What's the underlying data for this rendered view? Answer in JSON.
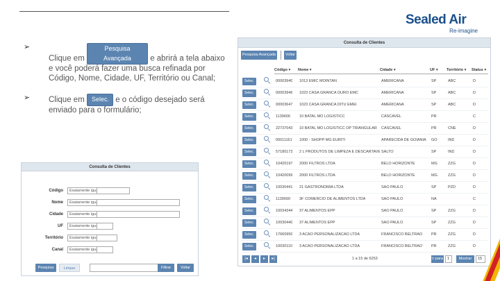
{
  "brand": {
    "name": "Sealed Air",
    "tagline": "Re-imagine",
    "colors": {
      "primary": "#1a4f8b",
      "button": "#5b84b1",
      "accent_red": "#d32027",
      "accent_yellow": "#f2b600"
    }
  },
  "bullets": [
    {
      "arrow": "➢",
      "before": "Clique em",
      "button": "Pesquisa Avançada",
      "after": "e abrirá a tela abaixo e você poderá fazer uma busca refinada por Código, Nome, Cidade, UF, Território ou Canal;"
    },
    {
      "arrow": "➢",
      "before": "Clique em",
      "button": "Selec.",
      "after": "e o código desejado será enviado para o formulário;"
    }
  ],
  "search_form": {
    "title": "Consulta de Clientes",
    "fields": [
      {
        "label": "Código",
        "operator": "Exatamente igual"
      },
      {
        "label": "Nome",
        "operator": "Exatamente igual"
      },
      {
        "label": "Cidade",
        "operator": "Exatamente igual"
      },
      {
        "label": "UF",
        "operator": "Exatamente igual"
      },
      {
        "label": "Território",
        "operator": "Exatamente igual"
      },
      {
        "label": "Canal",
        "operator": "Exatamente igual"
      }
    ],
    "buttons": {
      "search": "Pesquisa",
      "clear": "Limpar",
      "filter": "Filtrar",
      "back": "Voltar"
    }
  },
  "grid": {
    "title": "Consulta de Clientes",
    "toolbar": {
      "advanced": "Pesquisa Avançada",
      "back": "Voltar"
    },
    "columns": [
      "Código",
      "Nome",
      "Cidade",
      "UF",
      "Território",
      "Status"
    ],
    "select_label": "Selec.",
    "rows": [
      [
        "00003940",
        "1013 EMIC MOINTAN",
        "AMERICANA",
        "SP",
        "ABC",
        "D"
      ],
      [
        "00003946",
        "1023 CASA GRANCA OURO EMC",
        "AMERICANA",
        "SP",
        "ABC",
        "D"
      ],
      [
        "00003647",
        "1023 CASA GRANCA DITU EMEI",
        "AMERICANA",
        "SP",
        "ABC",
        "D"
      ],
      [
        "1139606",
        "10 BATAL MO LOGISTICC",
        "CASCAVEL",
        "PR",
        "",
        "C"
      ],
      [
        "22737043",
        "10 BATAL MO LOGISTICC OP TRIANGULAR",
        "CASCAVEL",
        "PR",
        "CNE",
        "D"
      ],
      [
        "00011161",
        "1000 - SHOPP MG EURITI",
        "APARECIDA DE GOIANIA",
        "GO",
        "IND",
        "D"
      ],
      [
        "57180173",
        "2 L PRODUTOS DE LIMPEZA E DESCARTAVEIS",
        "SALTO",
        "SP",
        "IND",
        "D"
      ],
      [
        "10420197",
        "2000 FILTROS LTDA",
        "BELO HORIZONTE",
        "MG",
        "ZZG",
        "D"
      ],
      [
        "10420099",
        "2000 FILTROS LTDA",
        "BELO HORIZONTE",
        "MG",
        "ZZG",
        "D"
      ],
      [
        "10030441",
        "21 GASTRONOMIA LTDA",
        "SAO PAULO",
        "SP",
        "PZD",
        "D"
      ],
      [
        "1139690",
        "3F COMERCIO DE ALIMENTOS LTDA",
        "SAO PAULO",
        "NA",
        "",
        "C"
      ],
      [
        "10034344",
        "37 ALIMENTOS EPP",
        "SAO PAULO",
        "SP",
        "ZZG",
        "D"
      ],
      [
        "10030440",
        "37 ALIMENTOS EPP",
        "SAO PAULO",
        "SP",
        "ZZG",
        "D"
      ],
      [
        "17660950",
        "3 ACAO PERSONALIZACAO LTDA",
        "FRANCISCO BELTRAO",
        "PR",
        "ZZG",
        "D"
      ],
      [
        "10030110",
        "3 ACAO PERSONALIZACAO LTDA",
        "FRANCISCO BELTRAO",
        "PR",
        "ZZG",
        "D"
      ]
    ],
    "pager": {
      "first": "|◂",
      "prev": "◂",
      "next": "▸",
      "last": "▸|",
      "info": "1 a 15 de 6253",
      "goto_label": "Ir para",
      "goto_value": "1",
      "show_label": "Mostrar",
      "show_value": "15"
    }
  }
}
